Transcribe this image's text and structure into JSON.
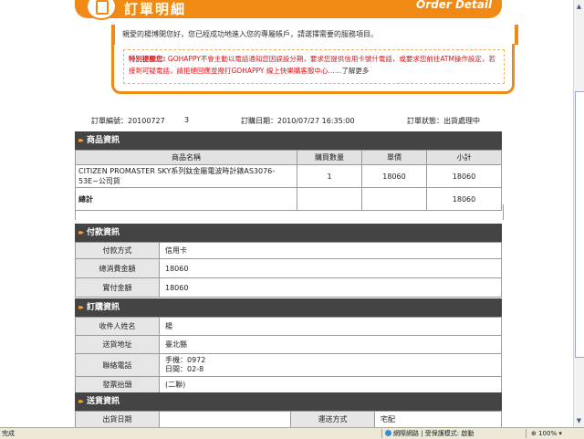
{
  "header": {
    "title_zh": "訂單明細",
    "title_en": "Order Detail"
  },
  "welcome": "親愛的楊博閔您好，您已經成功地進入您的專屬帳戶，請選擇需要的服務項目。",
  "notice": {
    "label": "特別提醒您:",
    "text": "GOHAPPY不會主動以電話通知您因誤設分期，要求您提供信用卡號什電話，或要求您前往ATM操作設定，若接到可疑電話，請拒絕回應並撥打GOHAPPY 線上快樂購客服中心……",
    "link": "了解更多"
  },
  "order": {
    "number_label": "訂單編號：20100727",
    "number_suffix": "3",
    "date_label": "訂購日期：2010/07/27 16:35:00",
    "status_label": "訂單狀態：出貨處理中"
  },
  "sections": {
    "product": "商品資訊",
    "payment": "付款資訊",
    "buyer": "訂購資訊",
    "shipping": "送貨資訊"
  },
  "product_table": {
    "headers": [
      "商品名稱",
      "購買數量",
      "單價",
      "小計"
    ],
    "rows": [
      {
        "name": "CITIZEN PROMASTER SKY系列鈦金屬電波時計錶AS3076-53E~公司貨",
        "qty": "1",
        "price": "18060",
        "subtotal": "18060"
      }
    ],
    "total_label": "總計",
    "total_value": "18060"
  },
  "payment": {
    "method_label": "付款方式",
    "method_value": "信用卡",
    "total_label": "總消費金額",
    "total_value": "18060",
    "paid_label": "實付金額",
    "paid_value": "18060"
  },
  "buyer": {
    "name_label": "收件人姓名",
    "name_value": "楊",
    "address_label": "送貨地址",
    "address_value": "臺北縣",
    "phone_label": "聯絡電話",
    "mobile_value": "手機：0972",
    "day_value": "日間：02-8",
    "invoice_label": "發票抬頭",
    "invoice_value": "(二聯)"
  },
  "shipping": {
    "date_label": "出貨日期",
    "date_value": "",
    "method_label": "運送方式",
    "method_value": "宅配"
  },
  "statusbar": {
    "left": "完成",
    "zone": "網際網路 | 受保護模式: 啟動",
    "zoom": "100%"
  }
}
